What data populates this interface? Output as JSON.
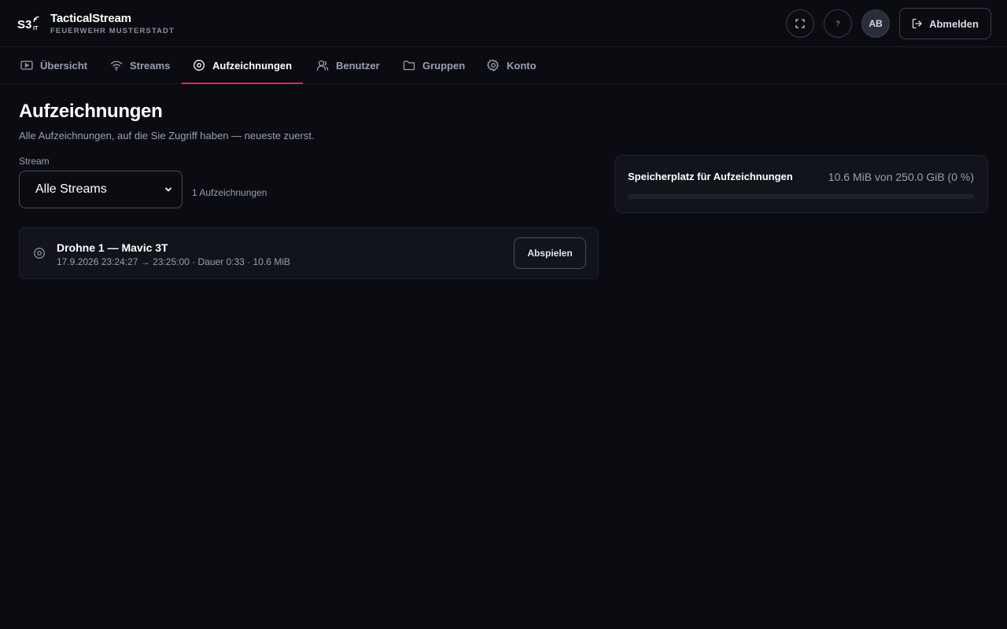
{
  "app": {
    "logo_text": "S3IT",
    "title": "TacticalStream",
    "subtitle": "FEUERWEHR MUSTERSTADT"
  },
  "header": {
    "fullscreen_icon": "fullscreen-icon",
    "help_label": "?",
    "avatar_initials": "AB",
    "logout_label": "Abmelden"
  },
  "tabs": [
    {
      "label": "Übersicht",
      "icon": "play-screen-icon"
    },
    {
      "label": "Streams",
      "icon": "wifi-icon"
    },
    {
      "label": "Aufzeichnungen",
      "icon": "record-icon",
      "active": true
    },
    {
      "label": "Benutzer",
      "icon": "user-icon"
    },
    {
      "label": "Gruppen",
      "icon": "folder-icon"
    },
    {
      "label": "Konto",
      "icon": "gear-icon"
    }
  ],
  "page": {
    "title": "Aufzeichnungen",
    "subtitle": "Alle Aufzeichnungen, auf die Sie Zugriff haben — neueste zuerst."
  },
  "filter": {
    "label": "Stream",
    "selected": "Alle Streams",
    "count_text": "1 Aufzeichnungen"
  },
  "recordings": [
    {
      "title": "Drohne 1 — Mavic 3T",
      "meta": "17.9.2026 23:24:27 → 23:25:00 · Dauer 0:33 · 10.6 MiB",
      "play_label": "Abspielen"
    }
  ],
  "storage": {
    "title": "Speicherplatz für Aufzeichnungen",
    "value_text": "10.6 MiB von 250.0 GiB (0 %)",
    "used_fraction": 0.0
  },
  "colors": {
    "accent": "#e0284a",
    "background": "#0b0c11",
    "surface": "#12141c"
  }
}
